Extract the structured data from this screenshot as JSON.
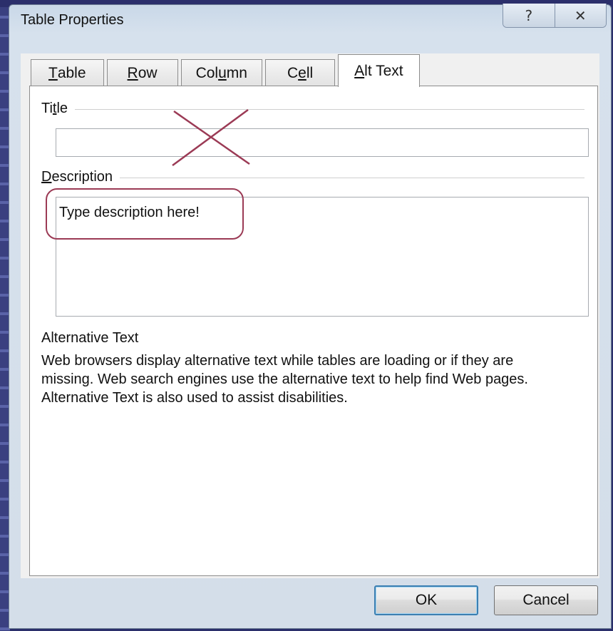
{
  "window": {
    "title": "Table Properties",
    "help_glyph": "?",
    "close_glyph": "✕"
  },
  "tabs": [
    {
      "label_pre": "",
      "label_ul": "T",
      "label_post": "able"
    },
    {
      "label_pre": "",
      "label_ul": "R",
      "label_post": "ow"
    },
    {
      "label_pre": "Col",
      "label_ul": "u",
      "label_post": "mn"
    },
    {
      "label_pre": "C",
      "label_ul": "e",
      "label_post": "ll"
    },
    {
      "label_pre": "",
      "label_ul": "A",
      "label_post": "lt Text"
    }
  ],
  "active_tab": "Alt Text",
  "title_field": {
    "label_pre": "Ti",
    "label_ul": "t",
    "label_post": "le",
    "value": ""
  },
  "description_field": {
    "label_pre": "",
    "label_ul": "D",
    "label_post": "escription",
    "value": "Type description here!"
  },
  "alt_text_section": {
    "heading": "Alternative Text",
    "lines": [
      "Web browsers display alternative text while tables are loading or if they are",
      "missing.  Web search engines use the alternative text to help find Web pages.",
      "Alternative Text is also used to assist disabilities."
    ]
  },
  "buttons": {
    "ok": "OK",
    "cancel": "Cancel"
  },
  "annotation_color": "#9b3a55"
}
